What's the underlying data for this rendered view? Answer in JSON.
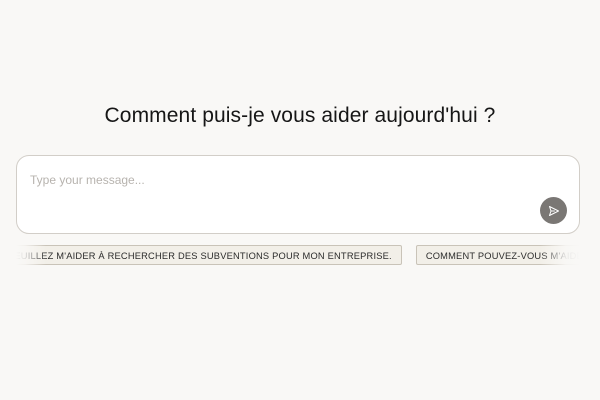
{
  "main": {
    "heading": "Comment puis-je vous aider aujourd'hui ?"
  },
  "composer": {
    "placeholder": "Type your message...",
    "value": "",
    "send_icon": "send-icon"
  },
  "suggestions": [
    {
      "label": "VEUILLEZ M'AIDER À RECHERCHER DES SUBVENTIONS POUR MON ENTREPRISE."
    },
    {
      "label": "COMMENT POUVEZ-VOUS M'AIDER ?"
    }
  ],
  "colors": {
    "background": "#f9f8f6",
    "send_button": "#7a7774",
    "chip_background": "#f2efe8",
    "chip_border": "#c9c3b8"
  }
}
